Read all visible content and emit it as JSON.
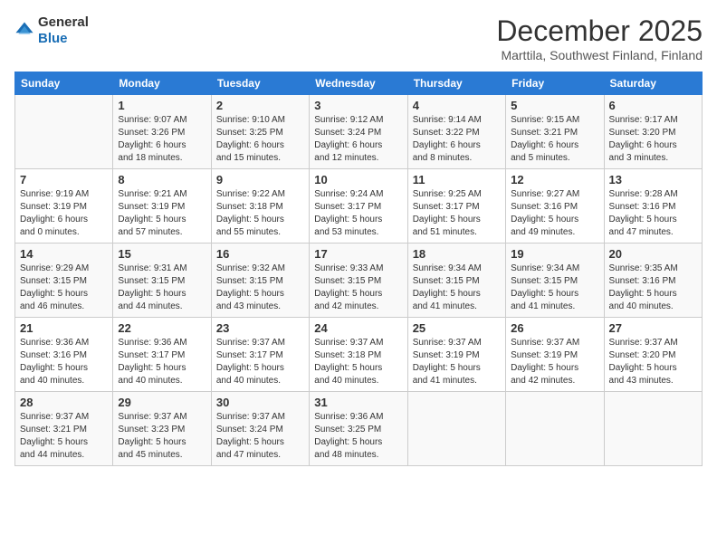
{
  "header": {
    "logo": {
      "general": "General",
      "blue": "Blue"
    },
    "title": "December 2025",
    "location": "Marttila, Southwest Finland, Finland"
  },
  "calendar": {
    "weekdays": [
      "Sunday",
      "Monday",
      "Tuesday",
      "Wednesday",
      "Thursday",
      "Friday",
      "Saturday"
    ],
    "weeks": [
      [
        {
          "day": "",
          "info": ""
        },
        {
          "day": "1",
          "info": "Sunrise: 9:07 AM\nSunset: 3:26 PM\nDaylight: 6 hours\nand 18 minutes."
        },
        {
          "day": "2",
          "info": "Sunrise: 9:10 AM\nSunset: 3:25 PM\nDaylight: 6 hours\nand 15 minutes."
        },
        {
          "day": "3",
          "info": "Sunrise: 9:12 AM\nSunset: 3:24 PM\nDaylight: 6 hours\nand 12 minutes."
        },
        {
          "day": "4",
          "info": "Sunrise: 9:14 AM\nSunset: 3:22 PM\nDaylight: 6 hours\nand 8 minutes."
        },
        {
          "day": "5",
          "info": "Sunrise: 9:15 AM\nSunset: 3:21 PM\nDaylight: 6 hours\nand 5 minutes."
        },
        {
          "day": "6",
          "info": "Sunrise: 9:17 AM\nSunset: 3:20 PM\nDaylight: 6 hours\nand 3 minutes."
        }
      ],
      [
        {
          "day": "7",
          "info": "Sunrise: 9:19 AM\nSunset: 3:19 PM\nDaylight: 6 hours\nand 0 minutes."
        },
        {
          "day": "8",
          "info": "Sunrise: 9:21 AM\nSunset: 3:19 PM\nDaylight: 5 hours\nand 57 minutes."
        },
        {
          "day": "9",
          "info": "Sunrise: 9:22 AM\nSunset: 3:18 PM\nDaylight: 5 hours\nand 55 minutes."
        },
        {
          "day": "10",
          "info": "Sunrise: 9:24 AM\nSunset: 3:17 PM\nDaylight: 5 hours\nand 53 minutes."
        },
        {
          "day": "11",
          "info": "Sunrise: 9:25 AM\nSunset: 3:17 PM\nDaylight: 5 hours\nand 51 minutes."
        },
        {
          "day": "12",
          "info": "Sunrise: 9:27 AM\nSunset: 3:16 PM\nDaylight: 5 hours\nand 49 minutes."
        },
        {
          "day": "13",
          "info": "Sunrise: 9:28 AM\nSunset: 3:16 PM\nDaylight: 5 hours\nand 47 minutes."
        }
      ],
      [
        {
          "day": "14",
          "info": "Sunrise: 9:29 AM\nSunset: 3:15 PM\nDaylight: 5 hours\nand 46 minutes."
        },
        {
          "day": "15",
          "info": "Sunrise: 9:31 AM\nSunset: 3:15 PM\nDaylight: 5 hours\nand 44 minutes."
        },
        {
          "day": "16",
          "info": "Sunrise: 9:32 AM\nSunset: 3:15 PM\nDaylight: 5 hours\nand 43 minutes."
        },
        {
          "day": "17",
          "info": "Sunrise: 9:33 AM\nSunset: 3:15 PM\nDaylight: 5 hours\nand 42 minutes."
        },
        {
          "day": "18",
          "info": "Sunrise: 9:34 AM\nSunset: 3:15 PM\nDaylight: 5 hours\nand 41 minutes."
        },
        {
          "day": "19",
          "info": "Sunrise: 9:34 AM\nSunset: 3:15 PM\nDaylight: 5 hours\nand 41 minutes."
        },
        {
          "day": "20",
          "info": "Sunrise: 9:35 AM\nSunset: 3:16 PM\nDaylight: 5 hours\nand 40 minutes."
        }
      ],
      [
        {
          "day": "21",
          "info": "Sunrise: 9:36 AM\nSunset: 3:16 PM\nDaylight: 5 hours\nand 40 minutes."
        },
        {
          "day": "22",
          "info": "Sunrise: 9:36 AM\nSunset: 3:17 PM\nDaylight: 5 hours\nand 40 minutes."
        },
        {
          "day": "23",
          "info": "Sunrise: 9:37 AM\nSunset: 3:17 PM\nDaylight: 5 hours\nand 40 minutes."
        },
        {
          "day": "24",
          "info": "Sunrise: 9:37 AM\nSunset: 3:18 PM\nDaylight: 5 hours\nand 40 minutes."
        },
        {
          "day": "25",
          "info": "Sunrise: 9:37 AM\nSunset: 3:19 PM\nDaylight: 5 hours\nand 41 minutes."
        },
        {
          "day": "26",
          "info": "Sunrise: 9:37 AM\nSunset: 3:19 PM\nDaylight: 5 hours\nand 42 minutes."
        },
        {
          "day": "27",
          "info": "Sunrise: 9:37 AM\nSunset: 3:20 PM\nDaylight: 5 hours\nand 43 minutes."
        }
      ],
      [
        {
          "day": "28",
          "info": "Sunrise: 9:37 AM\nSunset: 3:21 PM\nDaylight: 5 hours\nand 44 minutes."
        },
        {
          "day": "29",
          "info": "Sunrise: 9:37 AM\nSunset: 3:23 PM\nDaylight: 5 hours\nand 45 minutes."
        },
        {
          "day": "30",
          "info": "Sunrise: 9:37 AM\nSunset: 3:24 PM\nDaylight: 5 hours\nand 47 minutes."
        },
        {
          "day": "31",
          "info": "Sunrise: 9:36 AM\nSunset: 3:25 PM\nDaylight: 5 hours\nand 48 minutes."
        },
        {
          "day": "",
          "info": ""
        },
        {
          "day": "",
          "info": ""
        },
        {
          "day": "",
          "info": ""
        }
      ]
    ]
  }
}
